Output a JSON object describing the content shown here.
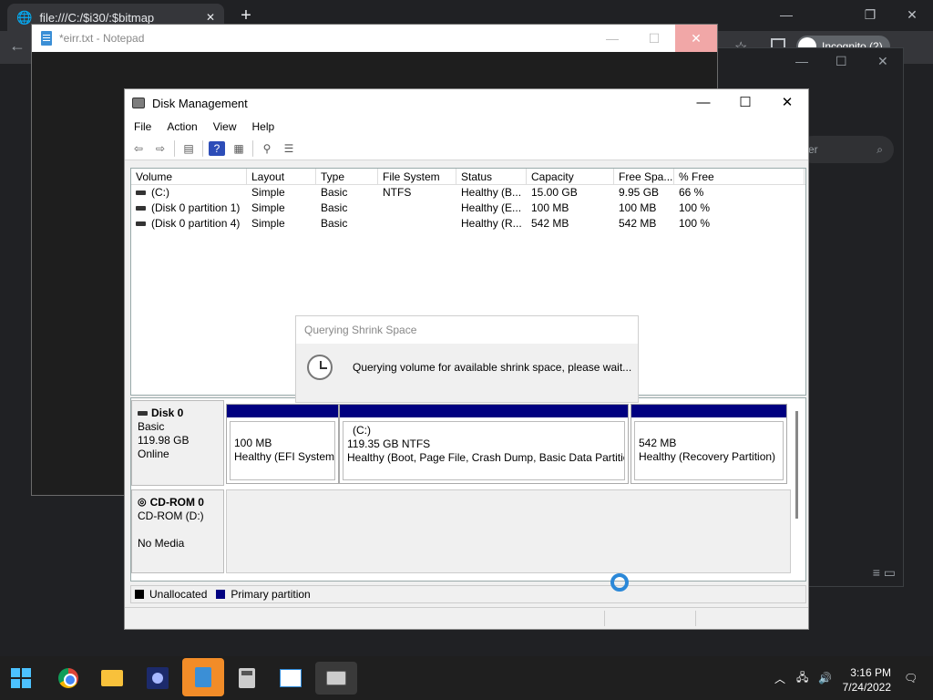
{
  "chrome": {
    "tab_title": "file:///C:/$i30/:$bitmap",
    "new_tab": "+",
    "minimize": "—",
    "restore": "❐",
    "close": "✕",
    "profile_label": "Incognito (2)",
    "search_placeholder": "er"
  },
  "notepad": {
    "title": "*eirr.txt - Notepad",
    "close": "✕"
  },
  "disk_mgmt": {
    "title": "Disk Management",
    "menu": [
      "File",
      "Action",
      "View",
      "Help"
    ],
    "columns": [
      "Volume",
      "Layout",
      "Type",
      "File System",
      "Status",
      "Capacity",
      "Free Spa...",
      "% Free"
    ],
    "volumes": [
      {
        "volume": "(C:)",
        "layout": "Simple",
        "type": "Basic",
        "fs": "NTFS",
        "status": "Healthy (B...",
        "capacity": "15.00 GB",
        "free": "9.95 GB",
        "pct": "66 %"
      },
      {
        "volume": "(Disk 0 partition 1)",
        "layout": "Simple",
        "type": "Basic",
        "fs": "",
        "status": "Healthy (E...",
        "capacity": "100 MB",
        "free": "100 MB",
        "pct": "100 %"
      },
      {
        "volume": "(Disk 0 partition 4)",
        "layout": "Simple",
        "type": "Basic",
        "fs": "",
        "status": "Healthy (R...",
        "capacity": "542 MB",
        "free": "542 MB",
        "pct": "100 %"
      }
    ],
    "disk0": {
      "name": "Disk 0",
      "type": "Basic",
      "size": "119.98 GB",
      "state": "Online",
      "partitions": [
        {
          "name": "",
          "size": "100 MB",
          "status": "Healthy (EFI System P"
        },
        {
          "name": "(C:)",
          "size": "119.35 GB NTFS",
          "status": "Healthy (Boot, Page File, Crash Dump, Basic Data Partition)"
        },
        {
          "name": "",
          "size": "542 MB",
          "status": "Healthy (Recovery Partition)"
        }
      ]
    },
    "cdrom": {
      "name": "CD-ROM 0",
      "drive": "CD-ROM (D:)",
      "media": "No Media"
    },
    "legend": {
      "unallocated": "Unallocated",
      "primary": "Primary partition",
      "unallocated_color": "#000000",
      "primary_color": "#000080"
    }
  },
  "dialog": {
    "title": "Querying Shrink Space",
    "message": "Querying volume for available shrink space, please wait..."
  },
  "taskbar": {
    "time": "3:16 PM",
    "date": "7/24/2022",
    "apps": [
      "start-icon",
      "chrome-icon",
      "file-explorer-icon",
      "galaxy-icon",
      "notepad-icon",
      "calculator-icon",
      "performance-monitor-icon",
      "disk-management-icon"
    ]
  }
}
